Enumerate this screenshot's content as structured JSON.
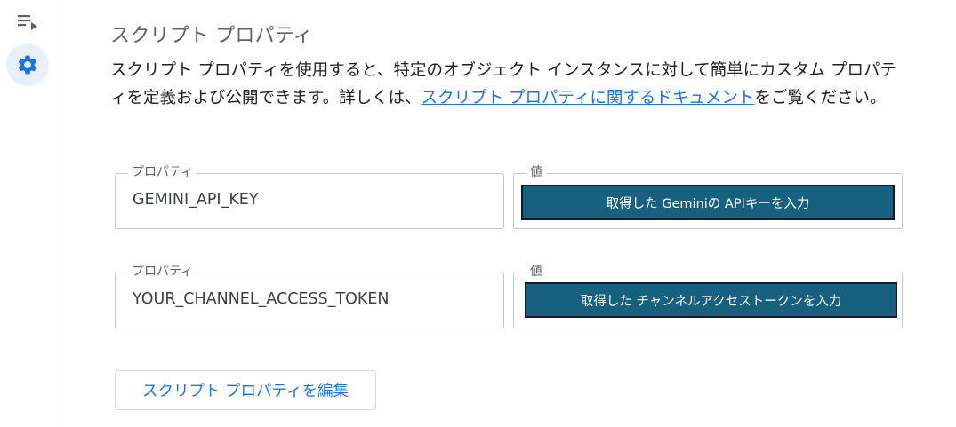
{
  "sidebar": {
    "items": [
      {
        "icon": "playlist-icon"
      },
      {
        "icon": "gear-icon",
        "active": true
      }
    ]
  },
  "section": {
    "title": "スクリプト プロパティ",
    "description_before": "スクリプト プロパティを使用すると、特定のオブジェクト インスタンスに対して簡単にカスタム プロパティを定義および公開できます。詳しくは、",
    "description_link": "スクリプト プロパティに関するドキュメント",
    "description_after": "をご覧ください。"
  },
  "properties": [
    {
      "property_label": "プロパティ",
      "property_name": "GEMINI_API_KEY",
      "value_label": "値",
      "value": "取得した Geminiの APIキーを入力"
    },
    {
      "property_label": "プロパティ",
      "property_name": "YOUR_CHANNEL_ACCESS_TOKEN",
      "value_label": "値",
      "value": "取得した チャンネルアクセストークンを入力"
    }
  ],
  "edit_button_label": "スクリプト プロパティを編集",
  "colors": {
    "accent": "#1a73e8",
    "value_fill": "#17607f",
    "active_nav_bg": "#e8f0fe"
  }
}
